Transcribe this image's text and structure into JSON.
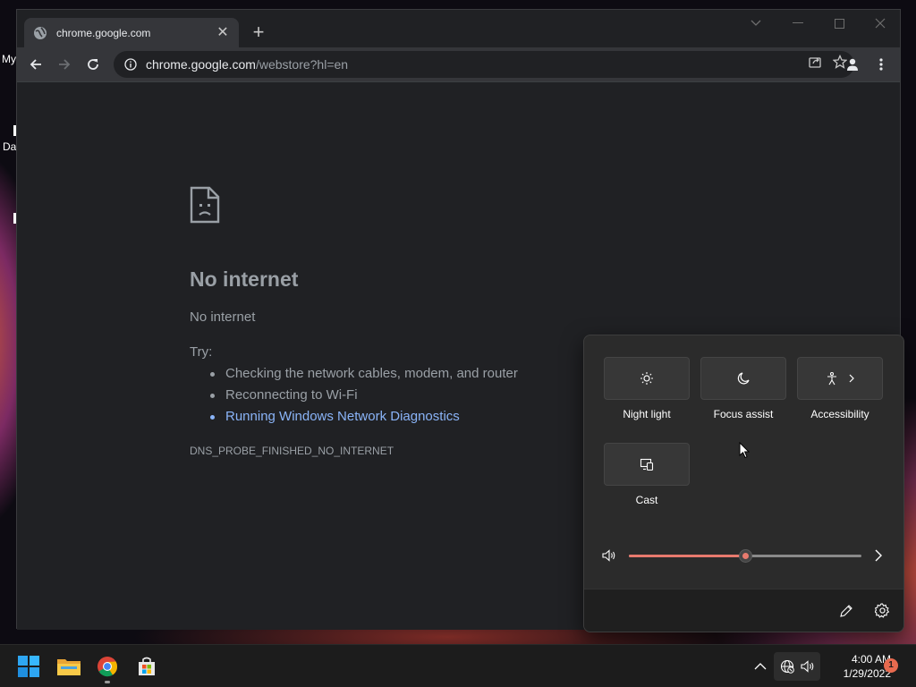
{
  "desktop": {
    "label_top": "My",
    "label_mid": "Da"
  },
  "browser": {
    "tab": {
      "title": "chrome.google.com",
      "close_glyph": "✕"
    },
    "new_tab_glyph": "+",
    "omnibox": {
      "host": "chrome.google.com",
      "path": "/webstore?hl=en"
    }
  },
  "error_page": {
    "title": "No internet",
    "subtitle": "No internet",
    "try_label": "Try:",
    "suggestions": [
      "Checking the network cables, modem, and router",
      "Reconnecting to Wi-Fi"
    ],
    "diagnostics_link": "Running Windows Network Diagnostics",
    "error_code": "DNS_PROBE_FINISHED_NO_INTERNET"
  },
  "quick_settings": {
    "tiles": [
      {
        "label": "Night light",
        "icon": "brightness-icon"
      },
      {
        "label": "Focus assist",
        "icon": "moon-icon"
      },
      {
        "label": "Accessibility",
        "icon": "accessibility-icon"
      },
      {
        "label": "Cast",
        "icon": "cast-icon"
      }
    ],
    "volume_level": 0.5
  },
  "taskbar": {
    "time": "4:00 AM",
    "date": "1/29/2022",
    "notification_count": "1"
  },
  "colors": {
    "accent": "#e87a6e",
    "link": "#8ab4f8",
    "badge": "#e86a4f"
  }
}
